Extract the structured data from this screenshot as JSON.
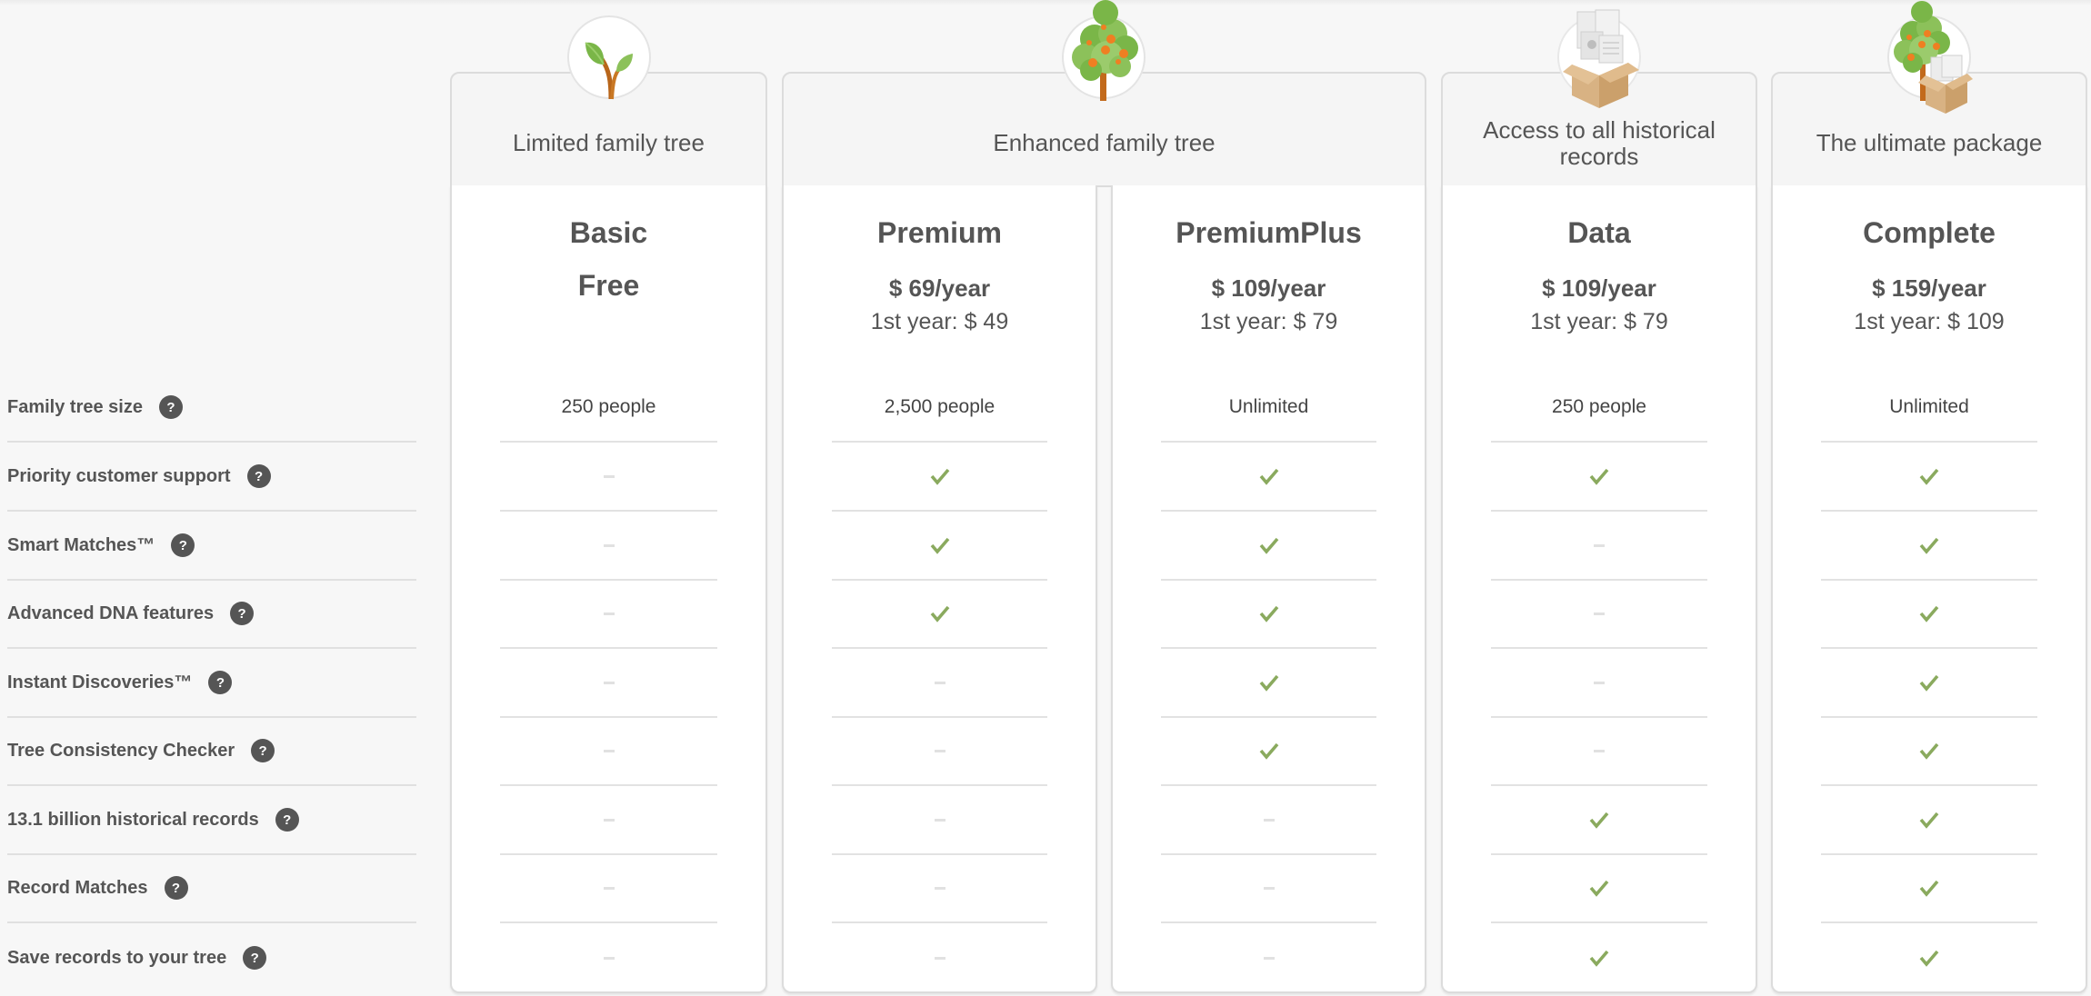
{
  "colors": {
    "check": "#8aaa5e",
    "dash": "#e1e1e1",
    "text": "#555555",
    "help_badge": "#555555",
    "background": "#f7f7f7"
  },
  "features": [
    {
      "label": "Family tree size",
      "help_icon": "question-icon"
    },
    {
      "label": "Priority customer support",
      "help_icon": "question-icon"
    },
    {
      "label": "Smart Matches™",
      "help_icon": "question-icon"
    },
    {
      "label": "Advanced DNA features",
      "help_icon": "question-icon"
    },
    {
      "label": "Instant Discoveries™",
      "help_icon": "question-icon"
    },
    {
      "label": "Tree Consistency Checker",
      "help_icon": "question-icon"
    },
    {
      "label": "13.1 billion historical records",
      "help_icon": "question-icon"
    },
    {
      "label": "Record Matches",
      "help_icon": "question-icon"
    },
    {
      "label": "Save records to your tree",
      "help_icon": "question-icon"
    }
  ],
  "help_glyph": "?",
  "groups": [
    {
      "title": "Limited family tree",
      "icon": "sprout-icon"
    },
    {
      "title": "Enhanced family tree",
      "icon": "fruit-tree-icon"
    },
    {
      "title": "Access to all historical records",
      "icon": "records-box-icon"
    },
    {
      "title": "The ultimate package",
      "icon": "tree-and-box-icon"
    }
  ],
  "plans": [
    {
      "name": "Basic",
      "price": "Free",
      "first_year": "",
      "values": [
        "250 people",
        "dash",
        "dash",
        "dash",
        "dash",
        "dash",
        "dash",
        "dash",
        "dash"
      ]
    },
    {
      "name": "Premium",
      "price": "$ 69/year",
      "first_year": "1st year: $ 49",
      "values": [
        "2,500 people",
        "check",
        "check",
        "check",
        "dash",
        "dash",
        "dash",
        "dash",
        "dash"
      ]
    },
    {
      "name": "PremiumPlus",
      "price": "$ 109/year",
      "first_year": "1st year: $ 79",
      "values": [
        "Unlimited",
        "check",
        "check",
        "check",
        "check",
        "check",
        "dash",
        "dash",
        "dash"
      ]
    },
    {
      "name": "Data",
      "price": "$ 109/year",
      "first_year": "1st year: $ 79",
      "values": [
        "250 people",
        "check",
        "dash",
        "dash",
        "dash",
        "dash",
        "check",
        "check",
        "check"
      ]
    },
    {
      "name": "Complete",
      "price": "$ 159/year",
      "first_year": "1st year: $ 109",
      "values": [
        "Unlimited",
        "check",
        "check",
        "check",
        "check",
        "check",
        "check",
        "check",
        "check"
      ]
    }
  ]
}
